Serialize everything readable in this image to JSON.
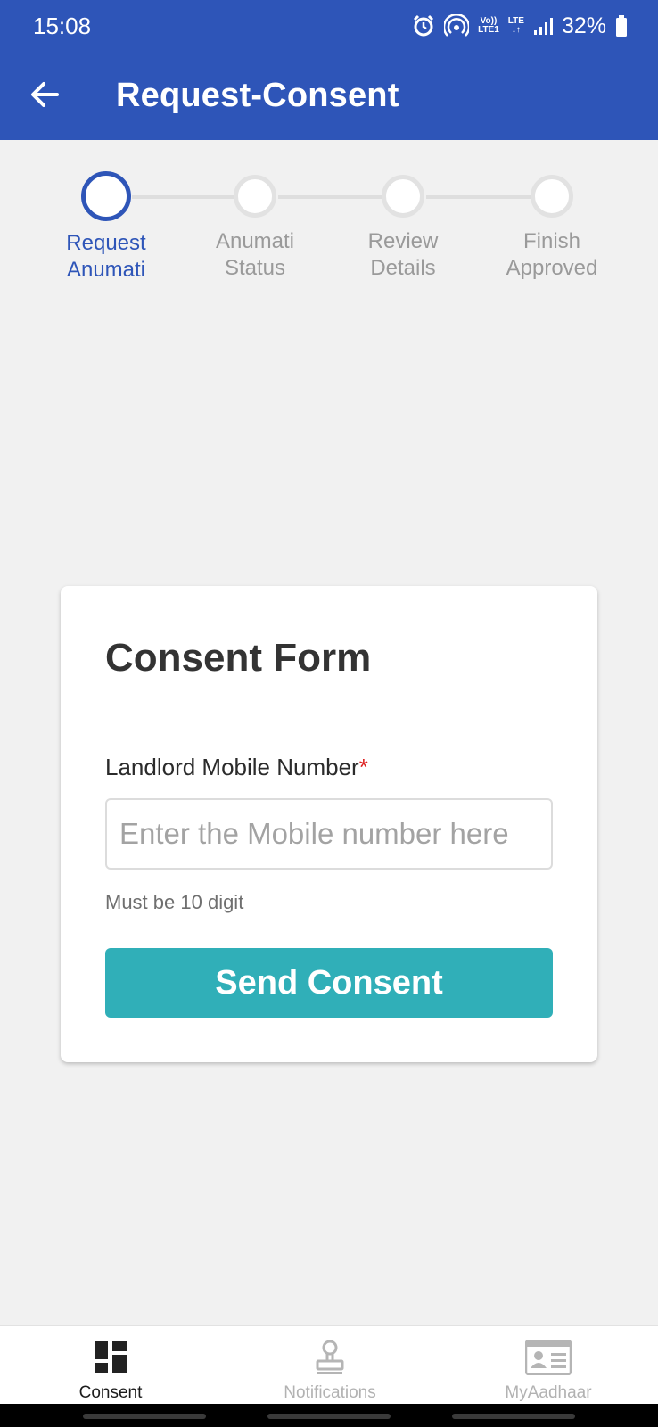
{
  "status_bar": {
    "time": "15:08",
    "net_top": "Vo))",
    "net_bottom": "LTE1",
    "lte_top": "LTE",
    "lte_bottom": "↓↑",
    "battery": "32%",
    "icons": [
      "alarm-icon",
      "hotspot-icon",
      "signal-icon",
      "battery-icon"
    ]
  },
  "app_bar": {
    "back_icon": "arrow-left-icon",
    "title": "Request-Consent",
    "color": "#2e55b8"
  },
  "stepper": {
    "steps": [
      {
        "line1": "Request",
        "line2": "Anumati",
        "state": "active"
      },
      {
        "line1": "Anumati",
        "line2": "Status",
        "state": "pending"
      },
      {
        "line1": "Review",
        "line2": "Details",
        "state": "pending"
      },
      {
        "line1": "Finish",
        "line2": "Approved",
        "state": "pending"
      }
    ]
  },
  "form": {
    "title": "Consent Form",
    "field_label": "Landlord Mobile Number",
    "required_mark": "*",
    "input_value": "",
    "input_placeholder": "Enter the Mobile number here",
    "helper": "Must be 10 digit",
    "submit_label": "Send Consent",
    "submit_color": "#30afb8"
  },
  "bottom_nav": {
    "items": [
      {
        "label": "Consent",
        "icon": "dashboard-icon",
        "active": true
      },
      {
        "label": "Notifications",
        "icon": "stamp-icon",
        "active": false
      },
      {
        "label": "MyAadhaar",
        "icon": "id-card-icon",
        "active": false
      }
    ]
  }
}
